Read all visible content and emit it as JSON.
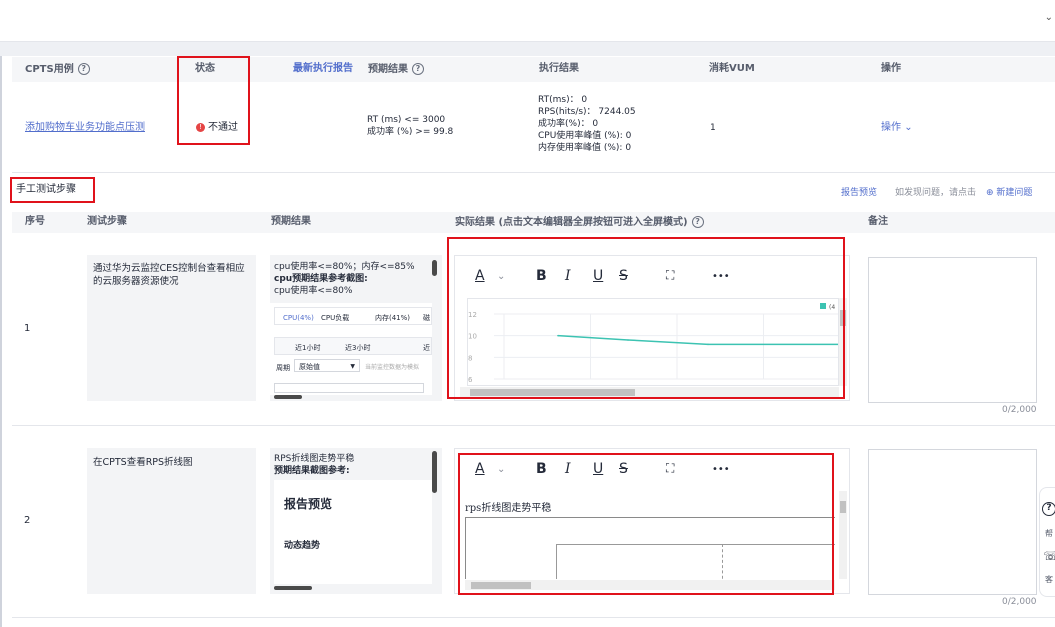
{
  "table1": {
    "headers": {
      "case": "CPTS用例",
      "status": "状态",
      "latest_report": "最新执行报告",
      "expected": "预期结果",
      "exec_result": "执行结果",
      "vum": "消耗VUM",
      "ops": "操作"
    },
    "row": {
      "case_link": "添加购物车业务功能点压测",
      "status": "不通过",
      "expected_lines": [
        "RT (ms) <= 3000",
        "成功率 (%) >= 99.8"
      ],
      "result_lines": [
        "RT(ms)： 0",
        "RPS(hits/s)： 7244.05",
        "成功率(%)： 0",
        "CPU使用率峰值 (%): 0",
        "内存使用率峰值 (%): 0"
      ],
      "vum": "1",
      "ops": "操作"
    }
  },
  "steps": {
    "section_title": "手工测试步骤",
    "report_preview": "报告预览",
    "issue_hint": "如发现问题，请点击",
    "new_issue": "新建问题",
    "headers": {
      "index": "序号",
      "step": "测试步骤",
      "expected": "预期结果",
      "actual": "实际结果 (点击文本编辑器全屏按钮可进入全屏模式)",
      "remark": "备注"
    },
    "rows": [
      {
        "index": "1",
        "step": "通过华为云监控CES控制台查看相应的云服务器资源使况",
        "expected_lines": [
          "cpu使用率<=80%；内存<=85%",
          "cpu预期结果参考截图:",
          "cpu使用率<=80%"
        ],
        "exp_tabs": [
          "CPU(4%)",
          "CPU负载",
          "内存(41%)",
          "磁"
        ],
        "exp_ranges": [
          "近1小时",
          "近3小时",
          "近"
        ],
        "exp_period_label": "周期",
        "exp_period_value": "原始值",
        "exp_hint": "当前监控数据为模拟",
        "chart_ticks": [
          "12",
          "10",
          "8",
          "6"
        ],
        "legend": "(4",
        "remark_count": "0/2,000"
      },
      {
        "index": "2",
        "step": "在CPTS查看RPS折线图",
        "expected_lines": [
          "RPS折线图走势平稳",
          "预期结果截图参考:"
        ],
        "exp_title": "报告预览",
        "exp_sub": "动态趋势",
        "actual_text": "rps折线图走势平稳",
        "remark_count": "0/2,000"
      }
    ]
  },
  "editor_toolbar": [
    "A",
    "B",
    "I",
    "U",
    "S",
    "⛶",
    "•••"
  ],
  "help": [
    "帮",
    "客"
  ],
  "colors": {
    "accent": "#526ecc",
    "error": "#e0121b",
    "chart_line": "#3cc3b2"
  },
  "chart_data": {
    "type": "line",
    "series": [
      {
        "values": [
          10.0,
          9.6,
          9.2,
          9.2
        ]
      }
    ],
    "ylim": [
      6,
      12
    ],
    "yticks": [
      "12",
      "10",
      "8",
      "6"
    ]
  }
}
